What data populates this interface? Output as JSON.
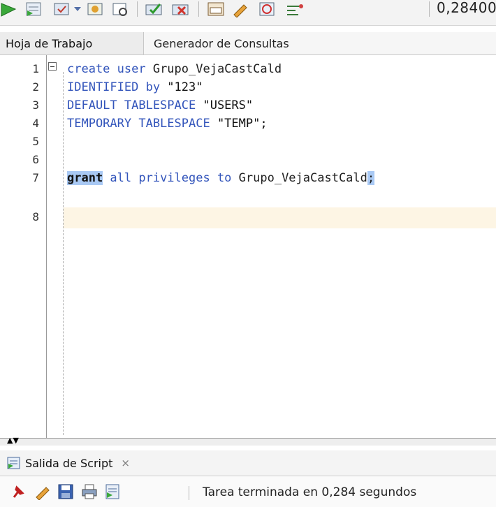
{
  "toolbar": {
    "icons": [
      "run-statement-icon",
      "run-script-icon",
      "commit-icon",
      "dropdown-icon",
      "rollback-icon",
      "explain-plan-icon",
      "autotrace-icon",
      "tuning-icon",
      "sql-history-icon",
      "clear-icon",
      "sql-tuning-advisor-icon",
      "format-icon"
    ],
    "timer": "0,284000"
  },
  "tabs": [
    {
      "label": "Hoja de Trabajo",
      "active": true
    },
    {
      "label": "Generador de Consultas",
      "active": false
    }
  ],
  "editor": {
    "line_numbers": [
      "1",
      "2",
      "3",
      "4",
      "5",
      "6",
      "7",
      "8"
    ],
    "lines": {
      "l1_kw": "create user",
      "l1_rest": " Grupo_VejaCastCald",
      "l2_kw": "IDENTIFIED by",
      "l2_rest": " \"123\"",
      "l3_kw": "DEFAULT TABLESPACE",
      "l3_rest": " \"USERS\"",
      "l4_kw": "TEMPORARY TABLESPACE",
      "l4_rest": " \"TEMP\";",
      "l6_grant": "grant",
      "l6_kw": " all privileges to",
      "l6_rest": " Grupo_VejaCastCald",
      "l6_semi": ";"
    },
    "current_line": "8"
  },
  "output": {
    "tab_label": "Salida de Script",
    "close_glyph": "×",
    "status": "Tarea terminada en 0,284 segundos"
  },
  "colors": {
    "keyword": "#3355bb",
    "selection": "#a9c9f4",
    "current_line": "#fdf5e4"
  }
}
